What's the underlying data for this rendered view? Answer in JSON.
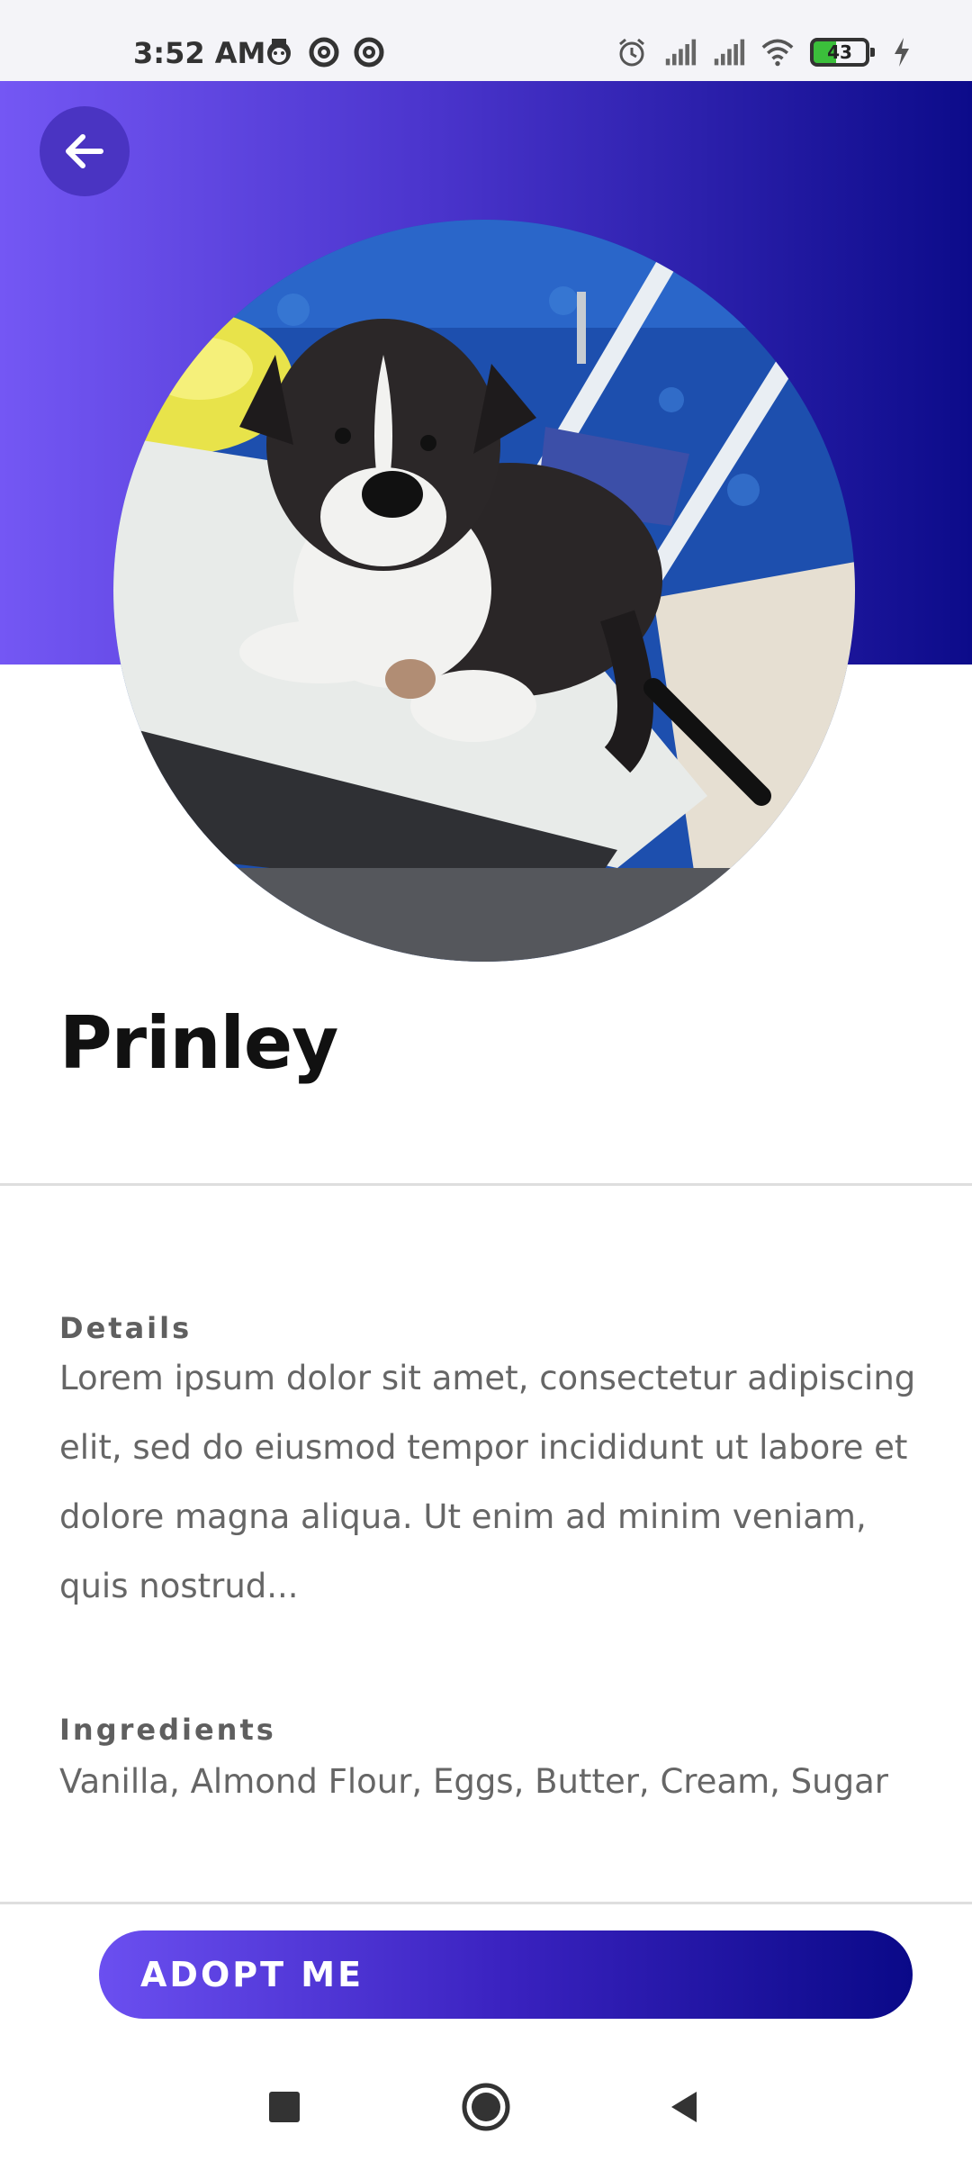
{
  "status_bar": {
    "time": "3:52 AM",
    "battery_level": "43",
    "left_icons": [
      "monkey-icon",
      "at-sign-icon",
      "at-sign-icon"
    ],
    "right_icons": [
      "alarm-icon",
      "signal-icon",
      "signal-icon",
      "wifi-icon",
      "battery-icon",
      "charging-icon"
    ]
  },
  "header": {
    "back_icon": "arrow-left-icon",
    "gradient_colors": [
      "#7457f4",
      "#0c0b8a"
    ]
  },
  "pet": {
    "name": "Prinley",
    "photo": "dog-photo"
  },
  "details": {
    "label": "Details",
    "text": "Lorem ipsum dolor sit amet, consectetur adipiscing elit, sed do eiusmod tempor incididunt ut labore et dolore magna aliqua. Ut enim ad minim veniam, quis nostrud..."
  },
  "ingredients": {
    "label": "Ingredients",
    "text": "Vanilla, Almond Flour, Eggs, Butter, Cream, Sugar"
  },
  "actions": {
    "adopt_label": "ADOPT ME",
    "accent_color": "#3a22c0"
  },
  "nav_bar": {
    "icons": [
      "square-icon",
      "circle-icon",
      "triangle-back-icon"
    ]
  }
}
